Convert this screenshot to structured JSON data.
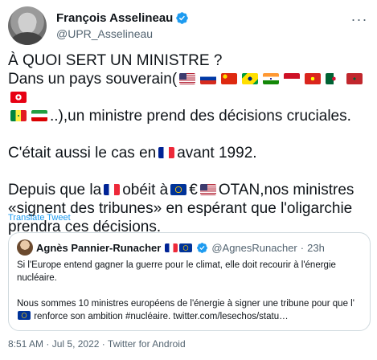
{
  "author": {
    "display_name": "François Asselineau",
    "handle": "@UPR_Asselineau",
    "verified": true
  },
  "tweet": {
    "line1": "À QUOI SERT UN MINISTRE ?",
    "line2_prefix": "Dans un pays souverain(",
    "line2_flags": [
      "us",
      "ru",
      "cn",
      "br",
      "in",
      "id",
      "vn",
      "dz",
      "ma",
      "tn"
    ],
    "line3_flags": [
      "sn",
      "ir"
    ],
    "line3_text": "..),un ministre prend des décisions cruciales.",
    "line4_prefix": "C'était aussi le cas en",
    "line4_flag": "fr",
    "line4_suffix": "avant 1992.",
    "line5_a": "Depuis que la",
    "line5_flag_fr": "fr",
    "line5_b": "obéit à",
    "line5_flag_eu": "eu",
    "line5_c": "€",
    "line5_flag_us": "us",
    "line5_d": "OTAN,nos ministres",
    "line6": "«signent des tribunes» en espérant que l'oligarchie",
    "line7": "prendra ces décisions."
  },
  "translate_label": "Translate Tweet",
  "quote": {
    "name": "Agnès Pannier-Runacher",
    "name_flags": [
      "fr",
      "eu"
    ],
    "handle": "@AgnesRunacher",
    "separator": "·",
    "time": "23h",
    "para1": "Si l'Europe entend gagner la guerre pour le climat, elle doit recourir à l'énergie nucléaire.",
    "para2_a": "Nous sommes 10 ministres européens de l'énergie à signer une tribune pour que l'",
    "para2_flag": "eu",
    "para2_b": " renforce son ambition #nucléaire. twitter.com/lesechos/statu…"
  },
  "meta": {
    "time": "8:51 AM",
    "date": "Jul 5, 2022",
    "source": "Twitter for Android",
    "separator": "·"
  }
}
